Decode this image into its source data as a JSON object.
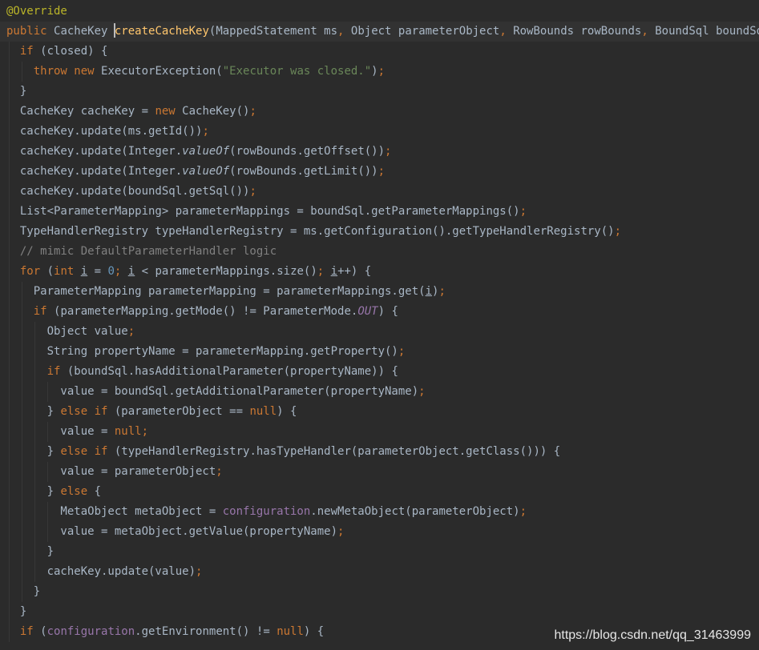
{
  "editor": {
    "language": "java",
    "theme": "darcula",
    "lines": [
      [
        {
          "t": "@Override",
          "c": "ann"
        }
      ],
      [
        {
          "t": "public ",
          "c": "kw"
        },
        {
          "t": "CacheKey "
        },
        {
          "caret": true
        },
        {
          "t": "createCacheKey",
          "c": "fn"
        },
        {
          "t": "(MappedStatement ms"
        },
        {
          "t": ", ",
          "c": "kw"
        },
        {
          "t": "Object parameterObject"
        },
        {
          "t": ", ",
          "c": "kw"
        },
        {
          "t": "RowBounds rowBounds"
        },
        {
          "t": ", ",
          "c": "kw"
        },
        {
          "t": "BoundSql boundSql) {"
        }
      ],
      [
        {
          "t": "  "
        },
        {
          "t": "if ",
          "c": "kw"
        },
        {
          "t": "(closed) {"
        }
      ],
      [
        {
          "t": "    "
        },
        {
          "t": "throw new ",
          "c": "kw"
        },
        {
          "t": "ExecutorException("
        },
        {
          "t": "\"Executor was closed.\"",
          "c": "str"
        },
        {
          "t": ")"
        },
        {
          "t": ";",
          "c": "kw"
        }
      ],
      [
        {
          "t": "  }"
        }
      ],
      [
        {
          "t": "  CacheKey cacheKey = "
        },
        {
          "t": "new ",
          "c": "kw"
        },
        {
          "t": "CacheKey()"
        },
        {
          "t": ";",
          "c": "kw"
        }
      ],
      [
        {
          "t": "  cacheKey.update(ms.getId())"
        },
        {
          "t": ";",
          "c": "kw"
        }
      ],
      [
        {
          "t": "  cacheKey.update(Integer."
        },
        {
          "t": "valueOf",
          "c": "st"
        },
        {
          "t": "(rowBounds.getOffset())"
        },
        {
          "t": ";",
          "c": "kw"
        }
      ],
      [
        {
          "t": "  cacheKey.update(Integer."
        },
        {
          "t": "valueOf",
          "c": "st"
        },
        {
          "t": "(rowBounds.getLimit())"
        },
        {
          "t": ";",
          "c": "kw"
        }
      ],
      [
        {
          "t": "  cacheKey.update(boundSql.getSql())"
        },
        {
          "t": ";",
          "c": "kw"
        }
      ],
      [
        {
          "t": "  List<ParameterMapping> parameterMappings = boundSql.getParameterMappings()"
        },
        {
          "t": ";",
          "c": "kw"
        }
      ],
      [
        {
          "t": "  TypeHandlerRegistry typeHandlerRegistry = ms.getConfiguration().getTypeHandlerRegistry()"
        },
        {
          "t": ";",
          "c": "kw"
        }
      ],
      [
        {
          "t": "  "
        },
        {
          "t": "// mimic DefaultParameterHandler logic",
          "c": "cmt"
        }
      ],
      [
        {
          "t": "  "
        },
        {
          "t": "for ",
          "c": "kw"
        },
        {
          "t": "("
        },
        {
          "t": "int ",
          "c": "kw"
        },
        {
          "t": "i",
          "c": "u"
        },
        {
          "t": " = "
        },
        {
          "t": "0",
          "c": "num"
        },
        {
          "t": "; ",
          "c": "kw"
        },
        {
          "t": "i",
          "c": "u"
        },
        {
          "t": " < parameterMappings.size()"
        },
        {
          "t": "; ",
          "c": "kw"
        },
        {
          "t": "i",
          "c": "u"
        },
        {
          "t": "++) {"
        }
      ],
      [
        {
          "t": "    ParameterMapping parameterMapping = parameterMappings.get("
        },
        {
          "t": "i",
          "c": "u"
        },
        {
          "t": ")"
        },
        {
          "t": ";",
          "c": "kw"
        }
      ],
      [
        {
          "t": "    "
        },
        {
          "t": "if ",
          "c": "kw"
        },
        {
          "t": "(parameterMapping.getMode() != ParameterMode."
        },
        {
          "t": "OUT",
          "c": "cst"
        },
        {
          "t": ") {"
        }
      ],
      [
        {
          "t": "      Object value"
        },
        {
          "t": ";",
          "c": "kw"
        }
      ],
      [
        {
          "t": "      String propertyName = parameterMapping.getProperty()"
        },
        {
          "t": ";",
          "c": "kw"
        }
      ],
      [
        {
          "t": "      "
        },
        {
          "t": "if ",
          "c": "kw"
        },
        {
          "t": "(boundSql.hasAdditionalParameter(propertyName)) {"
        }
      ],
      [
        {
          "t": "        value = boundSql.getAdditionalParameter(propertyName)"
        },
        {
          "t": ";",
          "c": "kw"
        }
      ],
      [
        {
          "t": "      } "
        },
        {
          "t": "else if ",
          "c": "kw"
        },
        {
          "t": "(parameterObject == "
        },
        {
          "t": "null",
          "c": "kw"
        },
        {
          "t": ") {"
        }
      ],
      [
        {
          "t": "        value = "
        },
        {
          "t": "null;",
          "c": "kw"
        }
      ],
      [
        {
          "t": "      } "
        },
        {
          "t": "else if ",
          "c": "kw"
        },
        {
          "t": "(typeHandlerRegistry.hasTypeHandler(parameterObject.getClass())) {"
        }
      ],
      [
        {
          "t": "        value = parameterObject"
        },
        {
          "t": ";",
          "c": "kw"
        }
      ],
      [
        {
          "t": "      } "
        },
        {
          "t": "else ",
          "c": "kw"
        },
        {
          "t": "{"
        }
      ],
      [
        {
          "t": "        MetaObject metaObject = "
        },
        {
          "t": "configuration",
          "c": "fld"
        },
        {
          "t": ".newMetaObject(parameterObject)"
        },
        {
          "t": ";",
          "c": "kw"
        }
      ],
      [
        {
          "t": "        value = metaObject.getValue(propertyName)"
        },
        {
          "t": ";",
          "c": "kw"
        }
      ],
      [
        {
          "t": "      }"
        }
      ],
      [
        {
          "t": "      cacheKey.update(value)"
        },
        {
          "t": ";",
          "c": "kw"
        }
      ],
      [
        {
          "t": "    }"
        }
      ],
      [
        {
          "t": "  }"
        }
      ],
      [
        {
          "t": "  "
        },
        {
          "t": "if ",
          "c": "kw"
        },
        {
          "t": "("
        },
        {
          "t": "configuration",
          "c": "fld"
        },
        {
          "t": ".getEnvironment() != "
        },
        {
          "t": "null",
          "c": "kw"
        },
        {
          "t": ") {"
        }
      ]
    ],
    "current_line": 1
  },
  "watermark": {
    "text": "https://blog.csdn.net/qq_31463999"
  }
}
